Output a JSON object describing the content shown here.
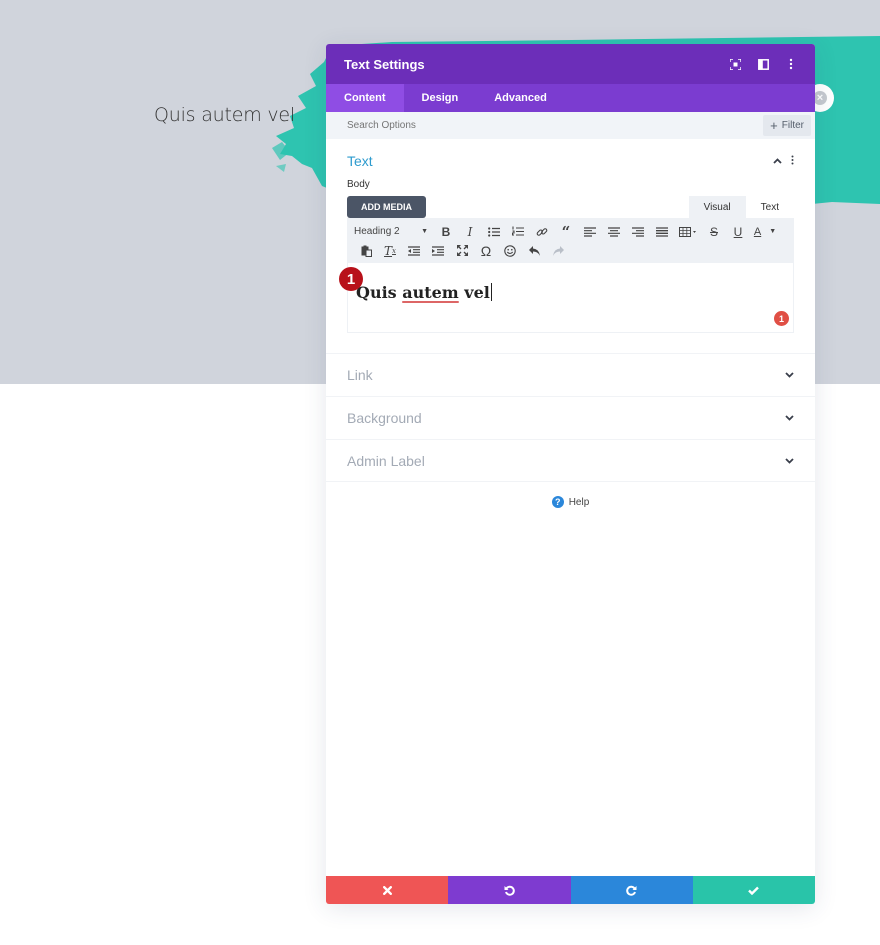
{
  "page": {
    "heading": "Quis autem vel",
    "colors": {
      "background_band": "#d0d4dc",
      "brush_teal": "#2ec4b0"
    }
  },
  "modal": {
    "title": "Text Settings",
    "header_icons": [
      "focus-icon",
      "sidebar-toggle-icon",
      "more-vertical-icon"
    ],
    "tabs": [
      {
        "label": "Content",
        "active": true
      },
      {
        "label": "Design",
        "active": false
      },
      {
        "label": "Advanced",
        "active": false
      }
    ],
    "search": {
      "placeholder": "Search Options",
      "value": ""
    },
    "filter_label": "Filter",
    "open_section": {
      "title": "Text",
      "body_label": "Body",
      "add_media_label": "ADD MEDIA",
      "mode_tabs": [
        {
          "label": "Visual",
          "active": true
        },
        {
          "label": "Text",
          "active": false
        }
      ],
      "format_select": "Heading 2",
      "toolbar_row1": [
        "bold",
        "italic",
        "bullet-list",
        "numbered-list",
        "link",
        "blockquote",
        "align-left",
        "align-center",
        "align-right",
        "align-justify",
        "table",
        "strikethrough",
        "underline",
        "text-color"
      ],
      "toolbar_row2": [
        "paste-as-text",
        "clear-formatting",
        "outdent",
        "indent",
        "fullscreen",
        "special-character",
        "emoji",
        "undo",
        "redo"
      ],
      "content": {
        "before": "Quis ",
        "misspelled": "autem",
        "after": " vel"
      },
      "error_count": "1"
    },
    "step_marker": "1",
    "sections": [
      {
        "title": "Link"
      },
      {
        "title": "Background"
      },
      {
        "title": "Admin Label"
      }
    ],
    "help_label": "Help",
    "footer": {
      "discard_color": "#ef5555",
      "undo_color": "#7e3bd0",
      "redo_color": "#2b87da",
      "save_color": "#29c4a9"
    }
  }
}
